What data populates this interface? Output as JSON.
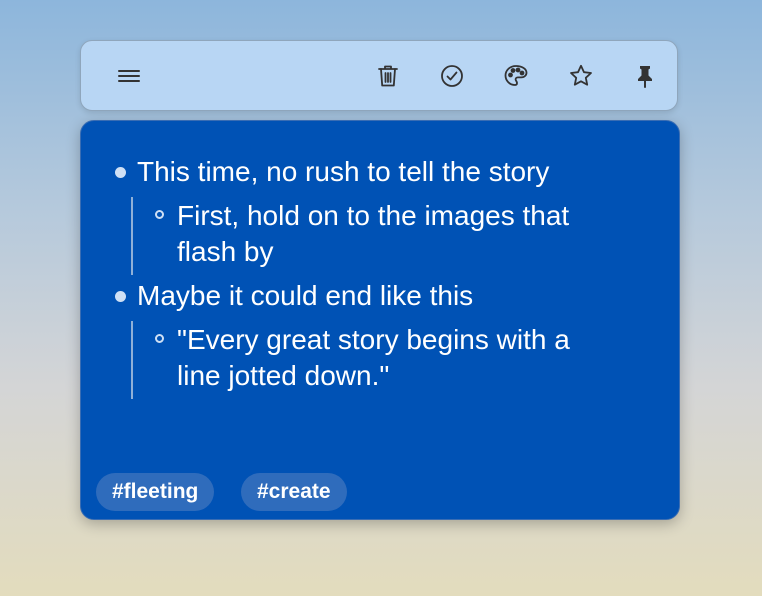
{
  "toolbar": {
    "icons": [
      "menu-icon",
      "trash-icon",
      "check-circle-icon",
      "palette-icon",
      "star-icon",
      "pin-icon"
    ]
  },
  "note": {
    "items": [
      {
        "level": 0,
        "text": "This time, no rush to tell the story"
      },
      {
        "level": 1,
        "lines": [
          "First, hold on to the images that",
          "flash by"
        ]
      },
      {
        "level": 0,
        "text": "Maybe it could end like this"
      },
      {
        "level": 1,
        "lines": [
          "\"Every great story begins with a",
          "line jotted down.\""
        ]
      }
    ],
    "tags": [
      "#fleeting",
      "#create"
    ]
  },
  "colors": {
    "note_bg": "#0052b5",
    "toolbar_bg": "#b8d6f4",
    "tag_bg": "#2f6cbc"
  }
}
